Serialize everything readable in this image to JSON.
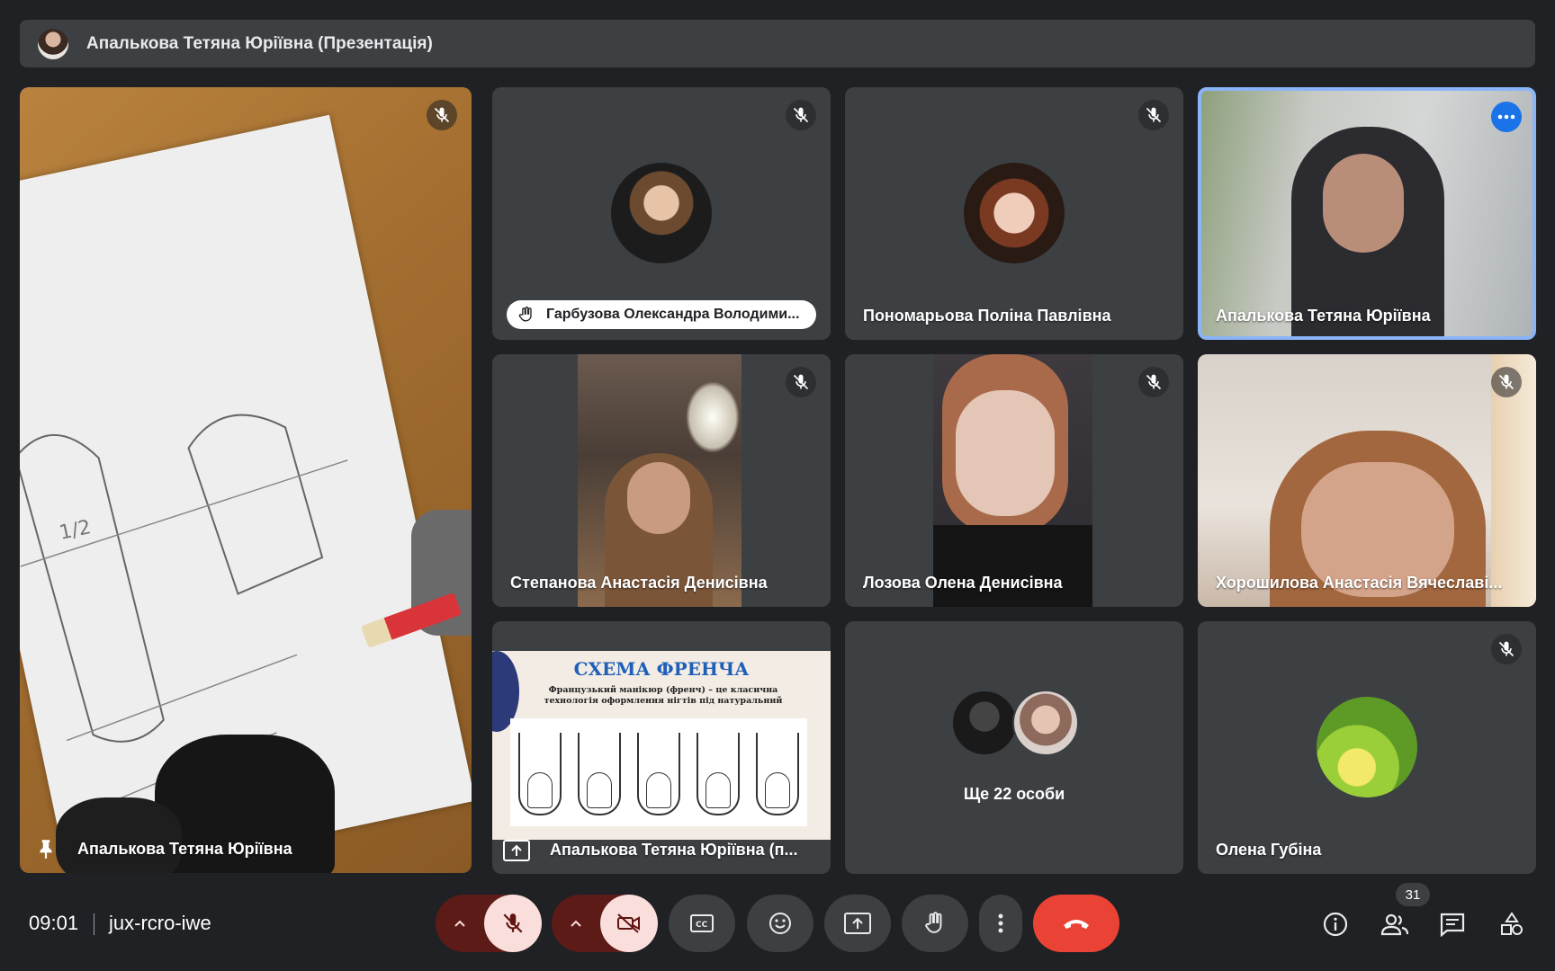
{
  "meeting": {
    "presenter_banner": "Апалькова Тетяна Юріївна (Презентація)",
    "time": "09:01",
    "code": "jux-rcro-iwe",
    "participant_count": "31"
  },
  "main_tile": {
    "name": "Апалькова Тетяна Юріївна"
  },
  "tiles": {
    "t1": {
      "name": "Гарбузова Олександра Володими..."
    },
    "t2": {
      "name": "Пономарьова Поліна Павлівна"
    },
    "t3": {
      "name": "Апалькова Тетяна Юріївна"
    },
    "t4": {
      "name": "Степанова Анастасія Денисівна"
    },
    "t5": {
      "name": "Лозова Олена Денисівна"
    },
    "t6": {
      "name": "Хорошилова Анастасія Вячеславі..."
    },
    "t7": {
      "name": "Апалькова Тетяна Юріївна (п..."
    },
    "t8": {
      "name": "Ще 22 особи"
    },
    "t9": {
      "name": "Олена Губіна"
    }
  },
  "slide": {
    "title": "СХЕМА ФРЕНЧА",
    "subtitle": "Французький манікюр (френч) – це класична технологія оформлення нігтів під натуральний"
  },
  "colors": {
    "accent": "#8ab4f8",
    "end_call": "#ea4335",
    "muted_bg": "#f9dedc"
  }
}
